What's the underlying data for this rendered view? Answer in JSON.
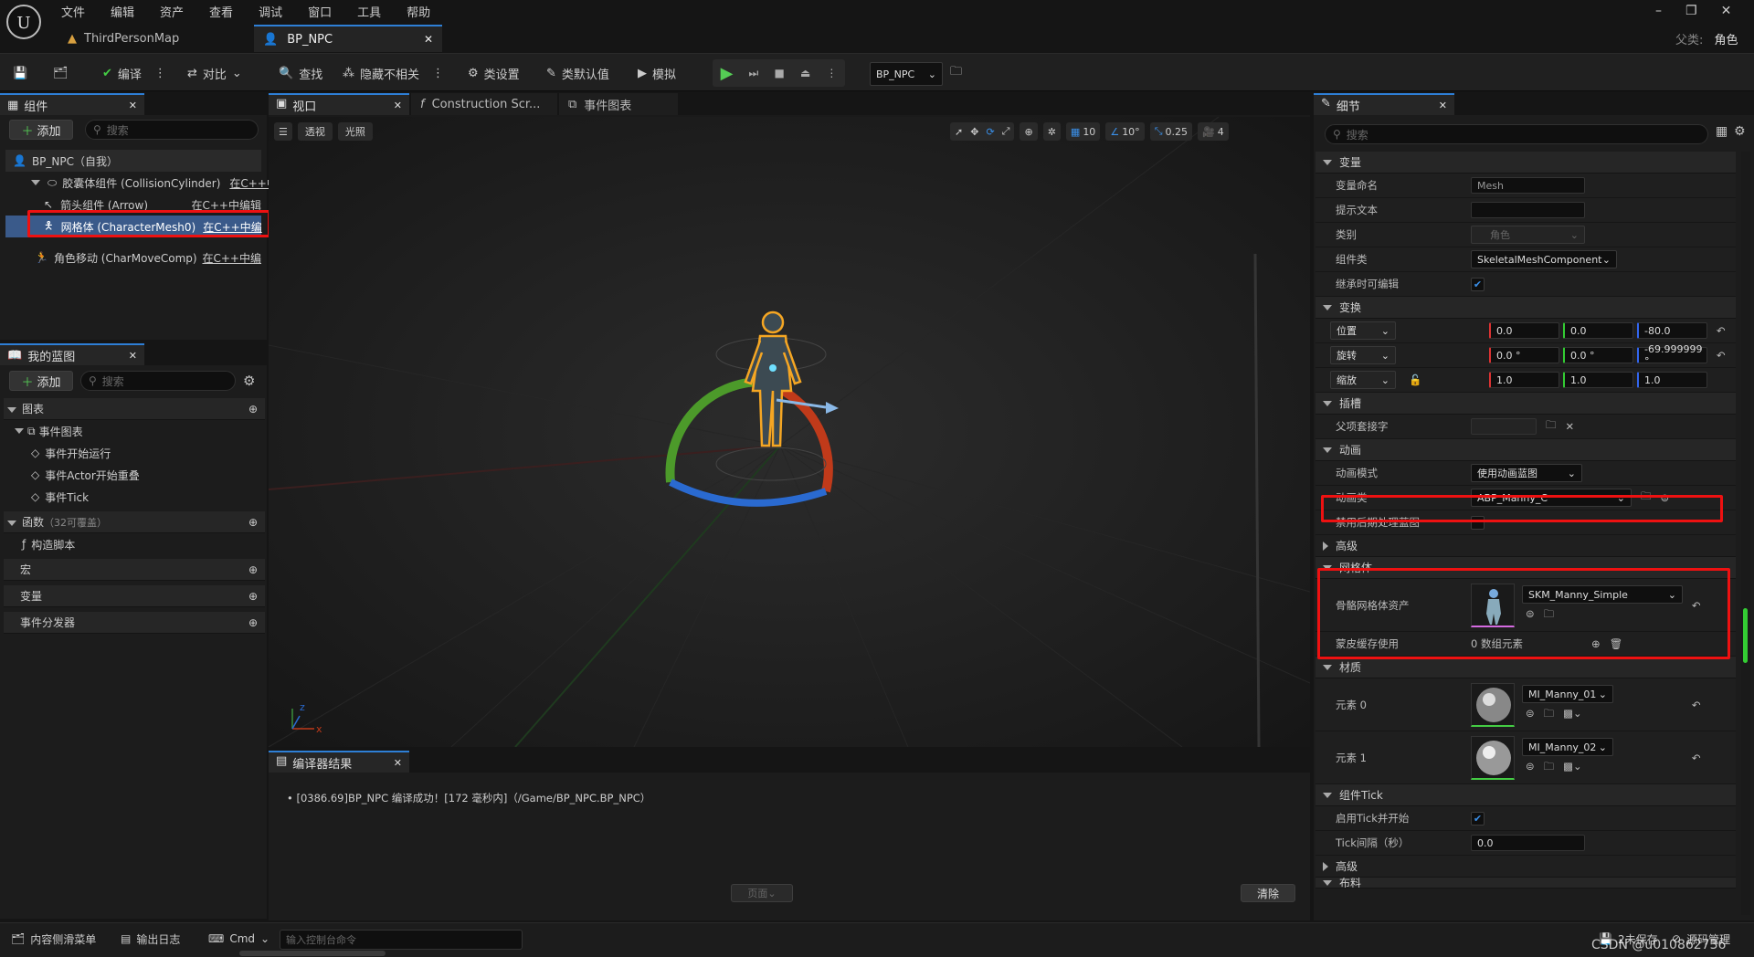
{
  "menu": [
    "文件",
    "编辑",
    "资产",
    "查看",
    "调试",
    "窗口",
    "工具",
    "帮助"
  ],
  "tabs": [
    {
      "label": "ThirdPersonMap"
    },
    {
      "label": "BP_NPC"
    }
  ],
  "parent": {
    "label": "父类:",
    "value": "角色"
  },
  "toolbar": {
    "compile": "编译",
    "diff": "对比",
    "find": "查找",
    "hide_unrelated": "隐藏不相关",
    "class_settings": "类设置",
    "class_defaults": "类默认值",
    "simulate": "模拟",
    "debug_target": "BP_NPC"
  },
  "components": {
    "title": "组件",
    "add": "添加",
    "search_placeholder": "搜索",
    "items": [
      {
        "name": "BP_NPC（自我）",
        "edit": ""
      },
      {
        "name": "胶囊体组件 (CollisionCylinder)",
        "edit": "在C++中"
      },
      {
        "name": "箭头组件 (Arrow)",
        "edit": "在C++中编辑"
      },
      {
        "name": "网格体 (CharacterMesh0)",
        "edit": "在C++中编"
      },
      {
        "name": "角色移动 (CharMoveComp)",
        "edit": "在C++中编"
      }
    ]
  },
  "myblueprint": {
    "title": "我的蓝图",
    "add": "添加",
    "search_placeholder": "搜索",
    "graphs": "图表",
    "event_graph": "事件图表",
    "events": [
      "事件开始运行",
      "事件Actor开始重叠",
      "事件Tick"
    ],
    "functions": "函数",
    "functions_note": "（32可覆盖）",
    "construction": "构造脚本",
    "macros": "宏",
    "variables": "变量",
    "dispatchers": "事件分发器"
  },
  "viewport": {
    "tabs": [
      "视口",
      "Construction Scr...",
      "事件图表"
    ],
    "perspective": "透视",
    "lit": "光照",
    "grid": "10",
    "angle": "10°",
    "scale": "0.25",
    "cam": "4"
  },
  "compiler": {
    "title": "编译器结果",
    "message": "[0386.69]BP_NPC 编译成功！[172 毫秒内]（/Game/BP_NPC.BP_NPC）",
    "page": "页面",
    "clear": "清除"
  },
  "details": {
    "title": "细节",
    "search_placeholder": "搜索",
    "variable": {
      "section": "变量",
      "name_label": "变量命名",
      "name_value": "Mesh",
      "tooltip_label": "提示文本",
      "category_label": "类别",
      "category_value": "角色",
      "class_label": "组件类",
      "class_value": "SkeletalMeshComponent",
      "editable_label": "继承时可编辑"
    },
    "transform": {
      "section": "变换",
      "location": "位置",
      "rotation": "旋转",
      "scale": "缩放",
      "loc": [
        "0.0",
        "0.0",
        "-80.0"
      ],
      "rot": [
        "0.0 °",
        "0.0 °",
        "-69.999999 °"
      ],
      "scl": [
        "1.0",
        "1.0",
        "1.0"
      ]
    },
    "sockets": {
      "section": "插槽",
      "parent_socket": "父项套接字"
    },
    "animation": {
      "section": "动画",
      "mode_label": "动画模式",
      "mode_value": "使用动画蓝图",
      "class_label": "动画类",
      "class_value": "ABP_Manny_C",
      "disable_post": "禁用后期处理蓝图",
      "advanced": "高级"
    },
    "mesh": {
      "section": "网格体",
      "asset_label": "骨骼网格体资产",
      "asset_value": "SKM_Manny_Simple",
      "skin_label": "蒙皮缓存使用",
      "skin_value": "0 数组元素"
    },
    "materials": {
      "section": "材质",
      "el0": "元素 0",
      "el0_value": "MI_Manny_01",
      "el1": "元素 1",
      "el1_value": "MI_Manny_02"
    },
    "tick": {
      "section": "组件Tick",
      "start_label": "启用Tick并开始",
      "interval_label": "Tick间隔（秒）",
      "interval_value": "0.0",
      "advanced": "高级",
      "next": "布料"
    }
  },
  "bottom": {
    "content_drawer": "内容侧滑菜单",
    "output_log": "输出日志",
    "cmd": "Cmd",
    "console_placeholder": "输入控制台命令",
    "save": "2未保存",
    "source": "源码管理",
    "watermark": "CSDN @u010862736"
  }
}
